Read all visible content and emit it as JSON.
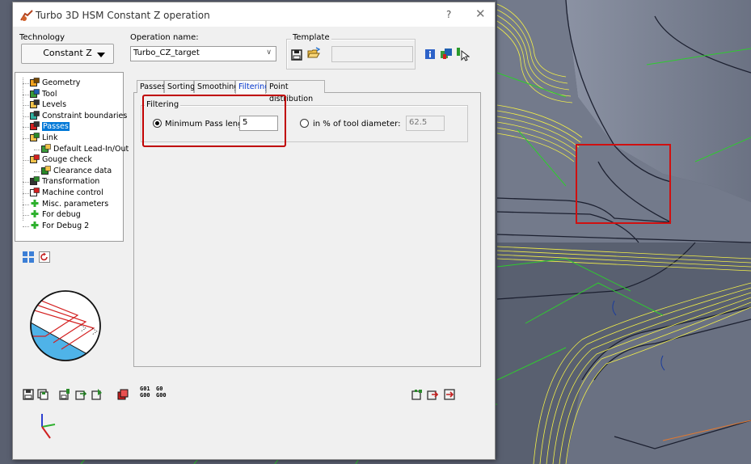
{
  "window": {
    "title": "Turbo 3D HSM Constant Z operation",
    "help_label": "?",
    "close_label": "✕"
  },
  "technology": {
    "label": "Technology",
    "value": "Constant Z"
  },
  "operation": {
    "label": "Operation name:",
    "value": "Turbo_CZ_target"
  },
  "template": {
    "label": "Template",
    "value": ""
  },
  "tree": {
    "items": [
      {
        "label": "Geometry",
        "icon": "geometry-icon",
        "level": 0
      },
      {
        "label": "Tool",
        "icon": "tool-icon",
        "level": 0
      },
      {
        "label": "Levels",
        "icon": "levels-icon",
        "level": 0
      },
      {
        "label": "Constraint boundaries",
        "icon": "constraint-boundaries-icon",
        "level": 0
      },
      {
        "label": "Passes",
        "icon": "passes-icon",
        "level": 0,
        "selected": true
      },
      {
        "label": "Link",
        "icon": "link-icon",
        "level": 0
      },
      {
        "label": "Default Lead-In/Out",
        "icon": "lead-in-out-icon",
        "level": 1
      },
      {
        "label": "Gouge check",
        "icon": "gouge-check-icon",
        "level": 0
      },
      {
        "label": "Clearance data",
        "icon": "clearance-data-icon",
        "level": 1
      },
      {
        "label": "Transformation",
        "icon": "transformation-icon",
        "level": 0
      },
      {
        "label": "Machine control",
        "icon": "machine-control-icon",
        "level": 0
      },
      {
        "label": "Misc. parameters",
        "icon": "plus-icon",
        "level": 0
      },
      {
        "label": "For debug",
        "icon": "plus-icon",
        "level": 0
      },
      {
        "label": "For Debug 2",
        "icon": "plus-icon",
        "level": 0
      }
    ]
  },
  "tabs": [
    {
      "label": "Passes",
      "active": false
    },
    {
      "label": "Sorting",
      "active": false
    },
    {
      "label": "Smoothing",
      "active": false
    },
    {
      "label": "Filtering",
      "active": true
    },
    {
      "label": "Point distribution",
      "active": false
    }
  ],
  "filtering": {
    "group_label": "Filtering",
    "min_pass_label": "Minimum Pass length:",
    "min_pass_value": "5",
    "min_pass_selected": true,
    "percent_label": "in % of tool diameter:",
    "percent_value": "62.5",
    "percent_selected": false
  },
  "gcode": {
    "g01_top": "G01",
    "g01_bottom": "G00",
    "g00_top": "G0",
    "g00_bottom": "G00"
  },
  "colors": {
    "highlight": "#c00000",
    "selection": "#0078d7",
    "viewport_bg": "#5d6474",
    "toolpath_yellow": "#f4f048",
    "toolpath_green": "#2ecc2e"
  }
}
